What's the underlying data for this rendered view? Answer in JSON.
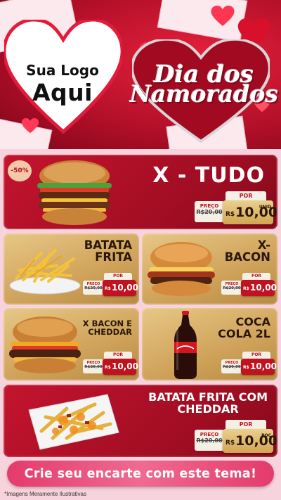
{
  "header": {
    "logo_line1": "Sua Logo",
    "logo_line2": "Aqui",
    "title_line1": "Dia dos",
    "title_line2": "Namorados"
  },
  "products": [
    {
      "id": "x-tudo",
      "name": "X - TUDO",
      "badge": "-50%",
      "old_label": "PREÇO",
      "old_price": "R$20,00",
      "new_label": "POR",
      "currency": "R$",
      "new_price": "10,00",
      "unit": "UNID"
    },
    {
      "id": "batata-frita",
      "name_line1": "BATATA",
      "name_line2": "FRITA",
      "old_label": "PREÇO",
      "old_price": "R$20,00",
      "new_label": "POR",
      "currency": "R$",
      "new_price": "10,00"
    },
    {
      "id": "x-bacon",
      "name_line1": "X-",
      "name_line2": "BACON",
      "old_label": "PREÇO",
      "old_price": "R$20,00",
      "new_label": "POR",
      "currency": "R$",
      "new_price": "10,00"
    },
    {
      "id": "x-bacon-cheddar",
      "name_line1": "X BACON E",
      "name_line2": "CHEDDAR",
      "old_label": "PREÇO",
      "old_price": "R$20,00",
      "new_label": "POR",
      "currency": "R$",
      "new_price": "10,00"
    },
    {
      "id": "coca-cola",
      "name_line1": "COCA",
      "name_line2": "COLA 2L",
      "old_label": "PREÇO",
      "old_price": "R$20,00",
      "new_label": "POR",
      "currency": "R$",
      "new_price": "10,00"
    },
    {
      "id": "batata-cheddar",
      "name_line1": "BATATA FRITA COM",
      "name_line2": "CHEDDAR",
      "old_label": "PREÇO",
      "old_price": "R$20,00",
      "new_label": "POR",
      "currency": "R$",
      "new_price": "10,00",
      "unit": "POÇ"
    }
  ],
  "cta": "Crie seu encarte com este tema!",
  "disclaimer": "*Imagens Meramente Ilustrativas",
  "colors": {
    "brand_red": "#c4142e",
    "dark_red": "#84091b",
    "gold": "#d2a552",
    "cream": "#f5f0e6",
    "cta_pink": "#e43b6b"
  }
}
